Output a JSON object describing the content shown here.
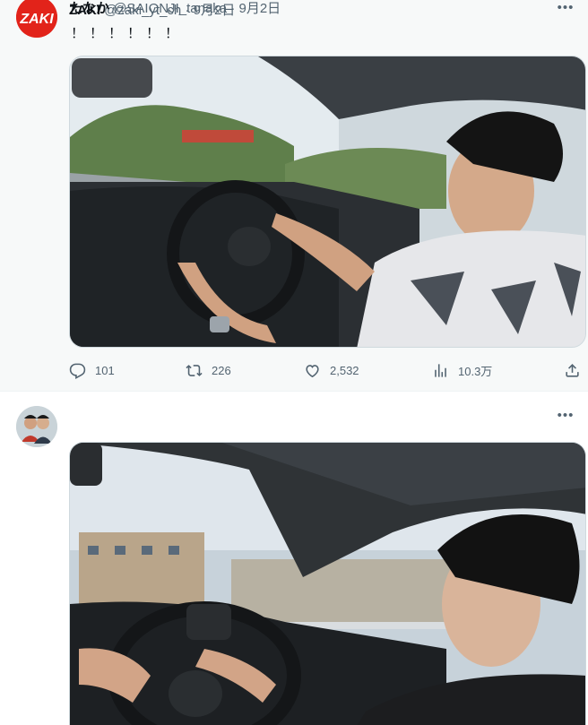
{
  "tweets": [
    {
      "avatar_label": "ZAKI",
      "name": "ZAKI",
      "handle": "@zaki_yt_ch",
      "separator": "·",
      "date": "9月2日",
      "text": "！！！！！！",
      "media_alt": "Man driving a Toyota car",
      "stats": {
        "replies": "101",
        "retweets": "226",
        "likes": "2,532",
        "views": "10.3万"
      }
    },
    {
      "name": "たなか",
      "handle": "@SAIONJI_tanaka",
      "separator": "·",
      "date": "9月2日",
      "media_alt": "Man driving a Toyota car"
    }
  ],
  "icons": {
    "more": "more-icon",
    "reply": "reply-icon",
    "retweet": "retweet-icon",
    "like": "heart-icon",
    "views": "views-icon",
    "share": "share-icon"
  },
  "colors": {
    "accent": "#1d9bf0",
    "avatar_bg": "#e2231a",
    "secondary_text": "#536471"
  }
}
